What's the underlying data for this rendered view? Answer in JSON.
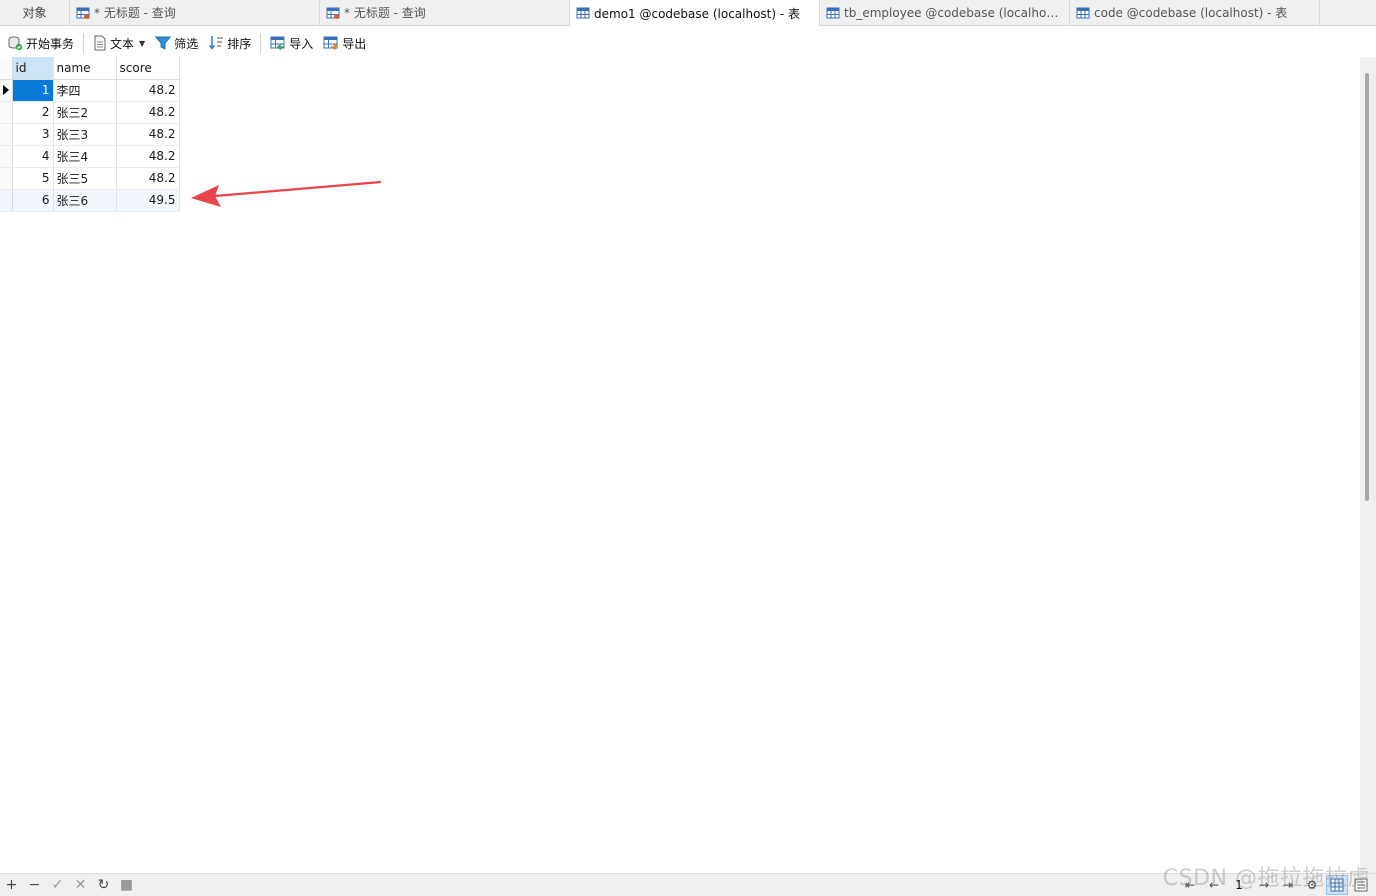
{
  "tabs": [
    {
      "label": "对象",
      "icon": "none"
    },
    {
      "label": "* 无标题 - 查询",
      "icon": "query-icon"
    },
    {
      "label": "* 无标题 - 查询",
      "icon": "query-icon"
    },
    {
      "label": "demo1 @codebase (localhost) - 表",
      "icon": "table-icon",
      "active": true
    },
    {
      "label": "tb_employee @codebase (localhost)...",
      "icon": "table-icon"
    },
    {
      "label": "code @codebase (localhost) - 表",
      "icon": "table-icon"
    }
  ],
  "toolbar": {
    "begin_transaction": "开始事务",
    "text": "文本",
    "filter": "筛选",
    "sort": "排序",
    "import": "导入",
    "export": "导出"
  },
  "grid": {
    "columns": [
      "id",
      "name",
      "score"
    ],
    "rows": [
      {
        "id": "1",
        "name": "李四",
        "score": "48.2"
      },
      {
        "id": "2",
        "name": "张三2",
        "score": "48.2"
      },
      {
        "id": "3",
        "name": "张三3",
        "score": "48.2"
      },
      {
        "id": "4",
        "name": "张三4",
        "score": "48.2"
      },
      {
        "id": "5",
        "name": "张三5",
        "score": "48.2"
      },
      {
        "id": "6",
        "name": "张三6",
        "score": "49.5"
      }
    ]
  },
  "statusbar": {
    "add": "+",
    "remove": "−",
    "apply": "✓",
    "discard": "✕",
    "refresh": "↻",
    "stop": "■",
    "page": "1"
  },
  "watermark": "CSDN @拖拉拖拉虎",
  "colors": {
    "selection": "#0a78d7",
    "annotation_arrow": "#e8464a"
  }
}
